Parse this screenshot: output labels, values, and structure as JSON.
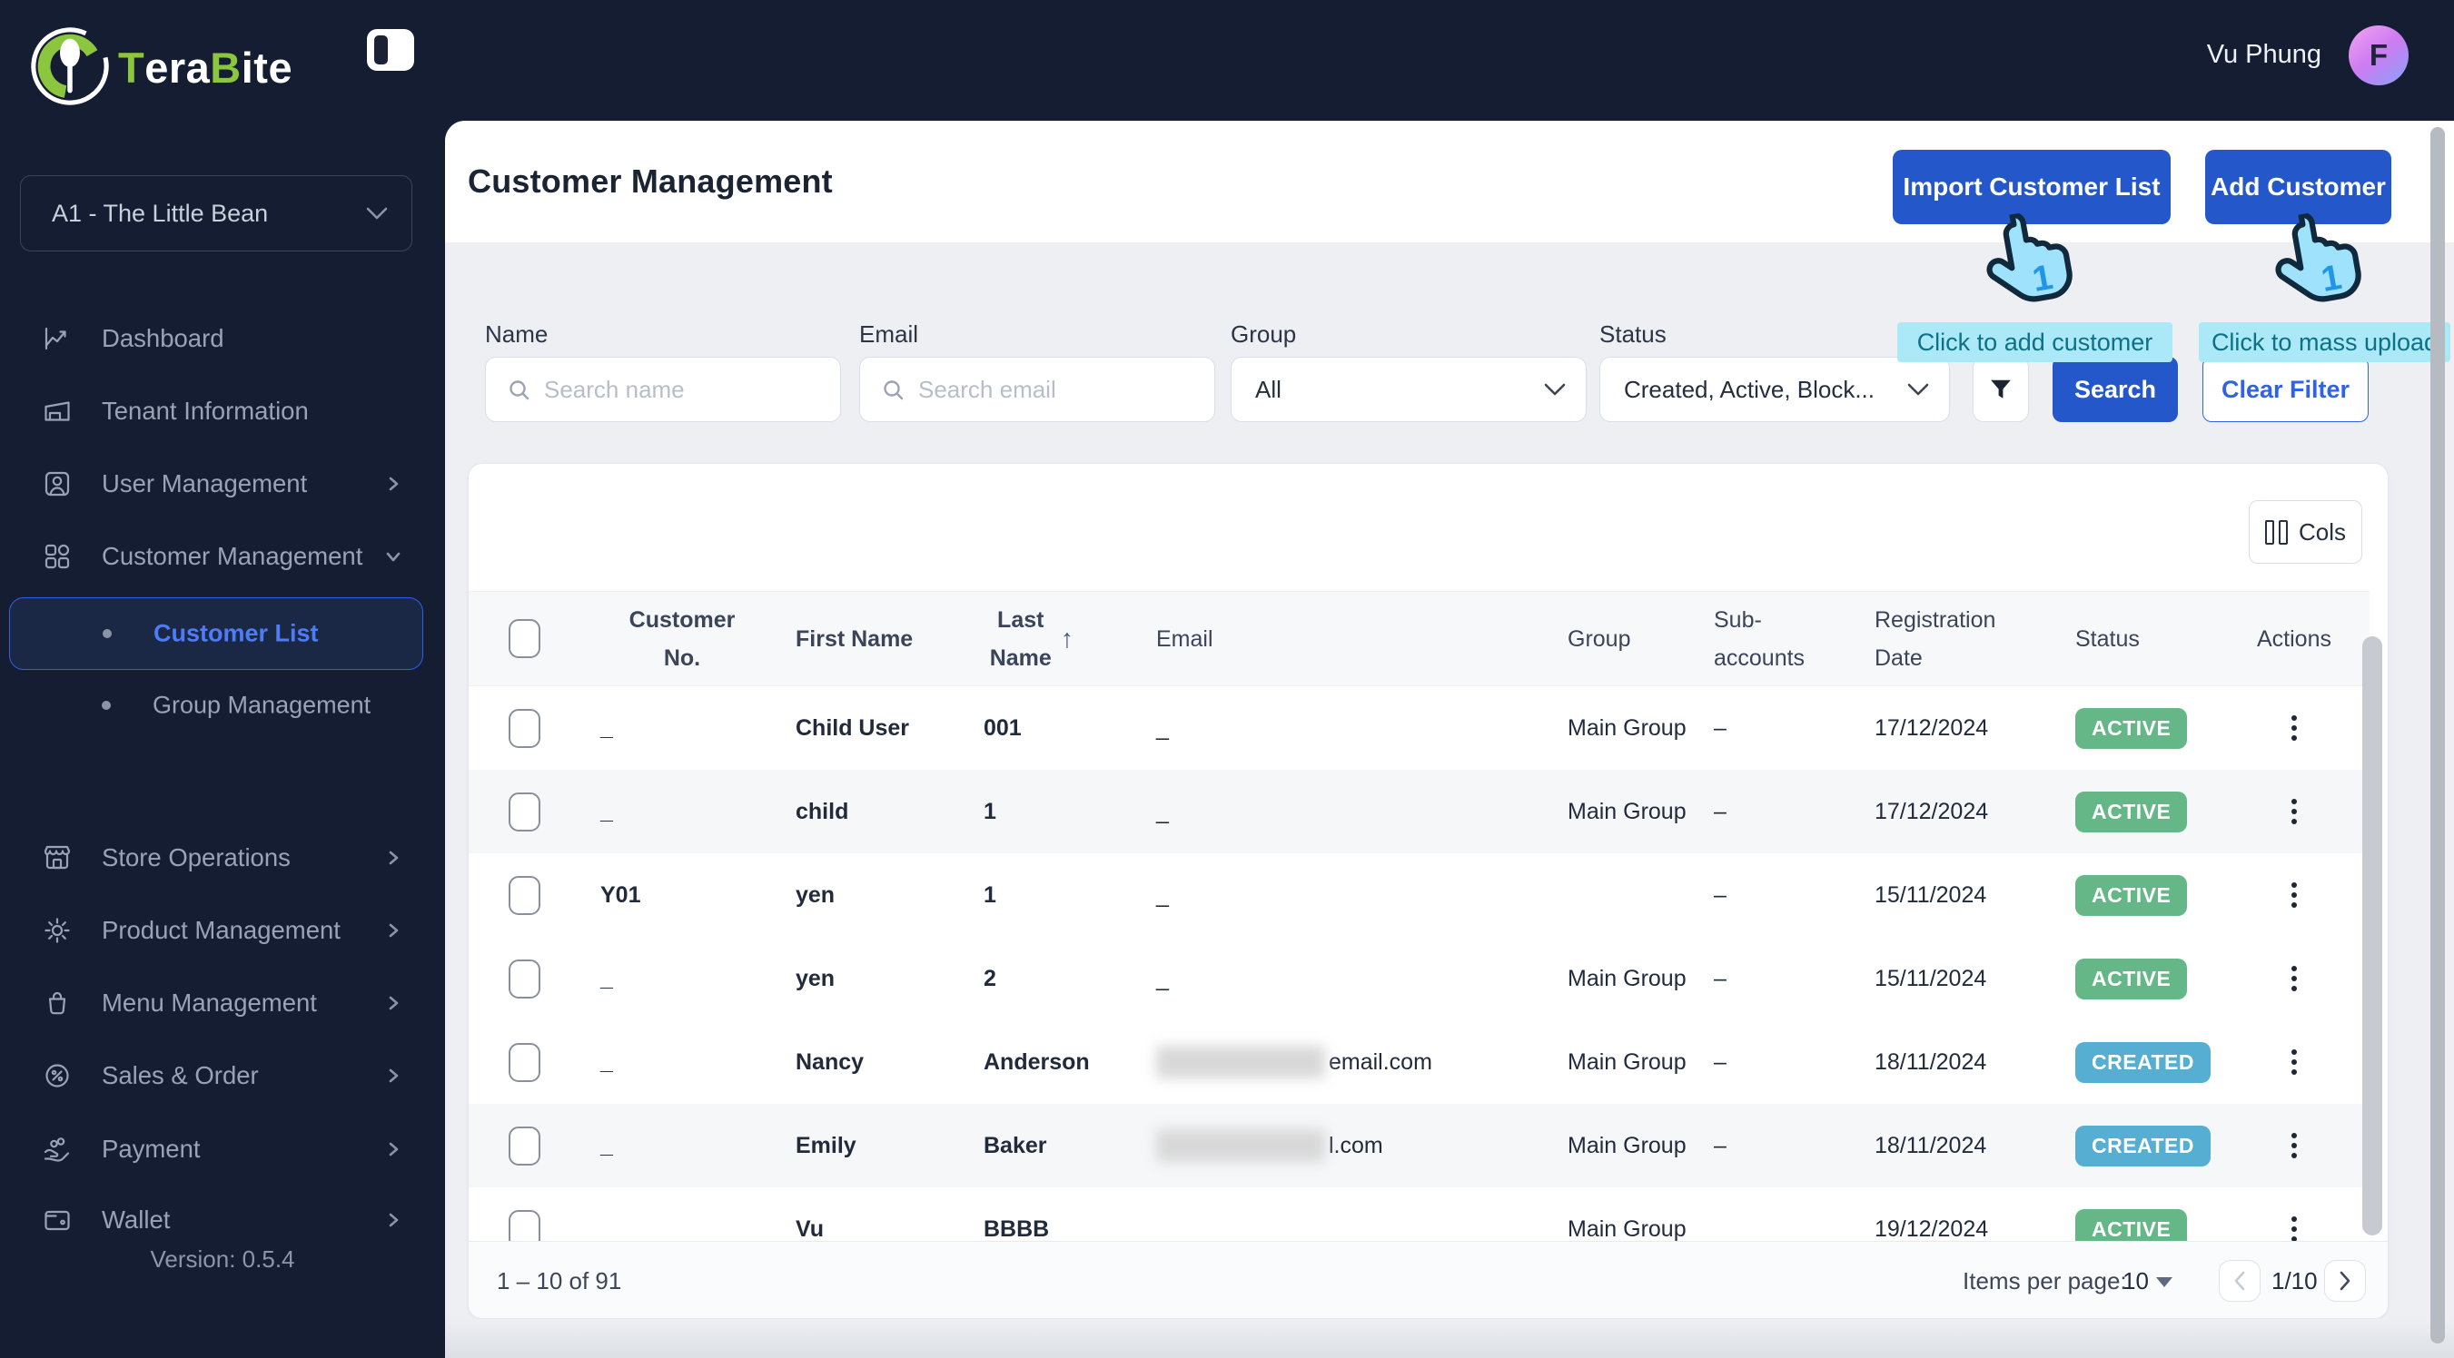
{
  "brand": {
    "logo_parts": [
      {
        "text": "T",
        "color": "#8cc63e"
      },
      {
        "text": "era",
        "color": "#ffffff"
      },
      {
        "text": "B",
        "color": "#8cc63e"
      },
      {
        "text": "ite",
        "color": "#ffffff"
      }
    ]
  },
  "sidebar": {
    "tenant_selector": {
      "value": "A1 - The Little Bean"
    },
    "items": [
      {
        "label": "Dashboard",
        "icon": "dashboard-icon",
        "chevron": "none"
      },
      {
        "label": "Tenant Information",
        "icon": "tenant-icon",
        "chevron": "none"
      },
      {
        "label": "User Management",
        "icon": "user-icon",
        "chevron": "right"
      },
      {
        "label": "Customer Management",
        "icon": "grid-icon",
        "chevron": "down",
        "expanded": true
      },
      {
        "label": "Store Operations",
        "icon": "store-icon",
        "chevron": "right"
      },
      {
        "label": "Product Management",
        "icon": "gear-icon",
        "chevron": "right"
      },
      {
        "label": "Menu Management",
        "icon": "bag-icon",
        "chevron": "right"
      },
      {
        "label": "Sales & Order",
        "icon": "percent-icon",
        "chevron": "right"
      },
      {
        "label": "Payment",
        "icon": "payment-icon",
        "chevron": "right"
      },
      {
        "label": "Wallet",
        "icon": "wallet-icon",
        "chevron": "right"
      }
    ],
    "subitems": [
      {
        "label": "Customer List",
        "active": true
      },
      {
        "label": "Group Management",
        "active": false
      }
    ],
    "version": "Version: 0.5.4"
  },
  "topbar": {
    "user_name": "Vu Phung",
    "avatar_initial": "F"
  },
  "page": {
    "title": "Customer Management",
    "import_button": "Import Customer List",
    "add_button": "Add Customer"
  },
  "annotations": {
    "tooltip_add": "Click to add customer",
    "tooltip_upload": "Click to mass upload",
    "cursor_label": "1"
  },
  "filters": {
    "name": {
      "label": "Name",
      "placeholder": "Search name",
      "value": ""
    },
    "email": {
      "label": "Email",
      "placeholder": "Search email",
      "value": ""
    },
    "group": {
      "label": "Group",
      "value": "All"
    },
    "status": {
      "label": "Status",
      "value": "Created, Active, Block..."
    },
    "search_button": "Search",
    "clear_button": "Clear Filter"
  },
  "table": {
    "cols_button": "Cols",
    "headers": [
      {
        "label": ""
      },
      {
        "label": "Customer\nNo."
      },
      {
        "label": "First Name"
      },
      {
        "label": "Last\nName",
        "sorted": "asc"
      },
      {
        "label": "Email"
      },
      {
        "label": "Group"
      },
      {
        "label": "Sub-\naccounts"
      },
      {
        "label": "Registration\nDate"
      },
      {
        "label": "Status"
      },
      {
        "label": "Actions"
      }
    ],
    "status_colors": {
      "ACTIVE": "#65b787",
      "CREATED": "#56aed3"
    },
    "rows": [
      {
        "customer_no": "_",
        "first_name": "Child User",
        "last_name": "001",
        "email": "_",
        "email_masked": false,
        "group": "Main Group",
        "sub_accounts": "–",
        "registration_date": "17/12/2024",
        "status": "ACTIVE",
        "shaded": false
      },
      {
        "customer_no": "_",
        "first_name": "child",
        "last_name": "1",
        "email": "_",
        "email_masked": false,
        "group": "Main Group",
        "sub_accounts": "–",
        "registration_date": "17/12/2024",
        "status": "ACTIVE",
        "shaded": true
      },
      {
        "customer_no": "Y01",
        "first_name": "yen",
        "last_name": "1",
        "email": "_",
        "email_masked": false,
        "group": "",
        "sub_accounts": "–",
        "registration_date": "15/11/2024",
        "status": "ACTIVE",
        "shaded": false
      },
      {
        "customer_no": "_",
        "first_name": "yen",
        "last_name": "2",
        "email": "_",
        "email_masked": false,
        "group": "Main Group",
        "sub_accounts": "–",
        "registration_date": "15/11/2024",
        "status": "ACTIVE",
        "shaded": false
      },
      {
        "customer_no": "_",
        "first_name": "Nancy",
        "last_name": "Anderson",
        "email": "email.com",
        "email_masked": true,
        "group": "Main Group",
        "sub_accounts": "–",
        "registration_date": "18/11/2024",
        "status": "CREATED",
        "shaded": false
      },
      {
        "customer_no": "_",
        "first_name": "Emily",
        "last_name": "Baker",
        "email": "l.com",
        "email_masked": true,
        "group": "Main Group",
        "sub_accounts": "–",
        "registration_date": "18/11/2024",
        "status": "CREATED",
        "shaded": true
      },
      {
        "customer_no": "",
        "first_name": "Vu",
        "last_name": "BBBB",
        "email": "",
        "email_masked": false,
        "group": "Main Group",
        "sub_accounts": "",
        "registration_date": "19/12/2024",
        "status": "ACTIVE",
        "shaded": false
      }
    ]
  },
  "pagination": {
    "range": "1 – 10 of 91",
    "items_per_page_label": "Items per page:",
    "per_page": "10",
    "page_indicator": "1/10"
  },
  "theme": {
    "accent_blue": "#2457c9",
    "outline_blue": "#2f62e9",
    "active_green": "#65b787",
    "created_blue": "#56aed3",
    "annotation_bg": "#abe9f8",
    "annotation_text": "#0d7085",
    "brand_green": "#8cc63e",
    "sidebar_bg": "#141d31"
  }
}
